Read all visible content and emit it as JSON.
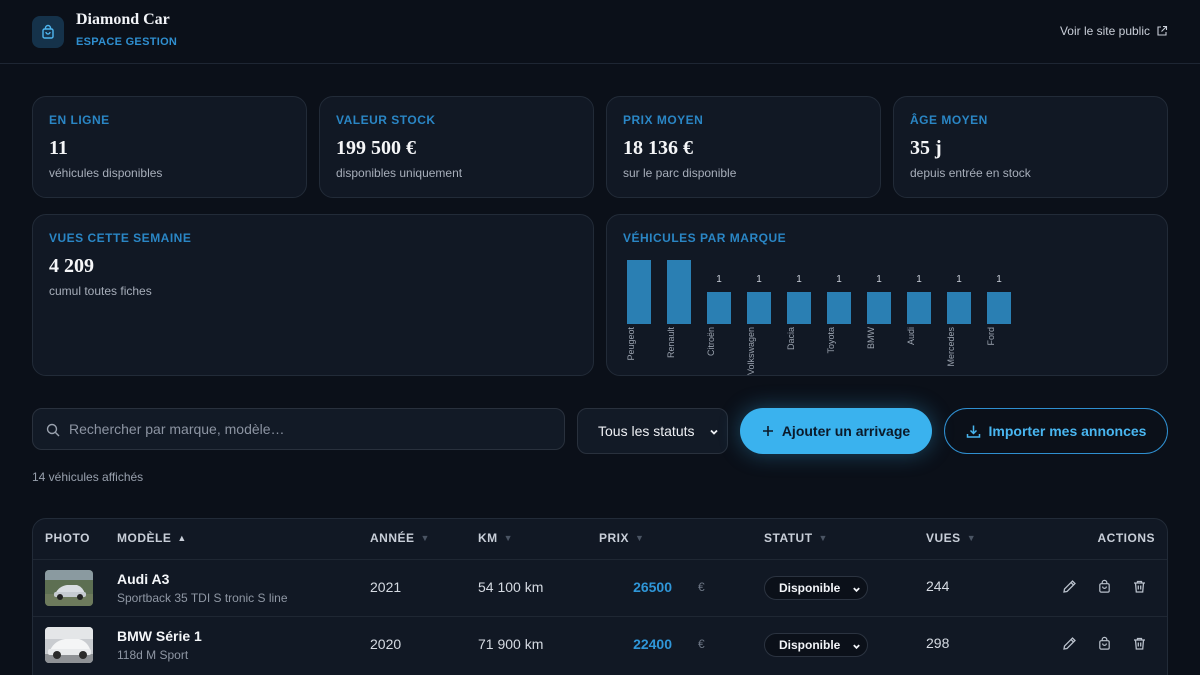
{
  "header": {
    "brand_name": "Diamond Car",
    "brand_sub": "ESPACE GESTION",
    "public_link": "Voir le site public"
  },
  "stats": [
    {
      "label": "EN LIGNE",
      "value": "11",
      "sub": "véhicules disponibles"
    },
    {
      "label": "VALEUR STOCK",
      "value": "199 500 €",
      "sub": "disponibles uniquement"
    },
    {
      "label": "PRIX MOYEN",
      "value": "18 136 €",
      "sub": "sur le parc disponible"
    },
    {
      "label": "ÂGE MOYEN",
      "value": "35 j",
      "sub": "depuis entrée en stock"
    },
    {
      "label": "VUES CETTE SEMAINE",
      "value": "4 209",
      "sub": "cumul toutes fiches"
    }
  ],
  "chart_data": {
    "type": "bar",
    "title": "VÉHICULES PAR MARQUE",
    "categories": [
      "Peugeot",
      "Renault",
      "Citroën",
      "Volkswagen",
      "Dacia",
      "Toyota",
      "BMW",
      "Audi",
      "Mercedes",
      "Ford"
    ],
    "values": [
      2,
      2,
      1,
      1,
      1,
      1,
      1,
      1,
      1,
      1
    ],
    "data_labels": [
      "",
      "",
      "1",
      "1",
      "1",
      "1",
      "1",
      "1",
      "1",
      "1"
    ],
    "ylim": [
      0,
      2
    ],
    "color": "#2a7fb3"
  },
  "toolbar": {
    "search_placeholder": "Rechercher par marque, modèle…",
    "status_filter": "Tous les statuts",
    "add_label": "Ajouter un arrivage",
    "import_label": "Importer mes annonces",
    "count_text": "14 véhicules affichés"
  },
  "table": {
    "headers": {
      "photo": "PHOTO",
      "model": "MODÈLE",
      "year": "ANNÉE",
      "km": "KM",
      "price": "PRIX",
      "status": "STATUT",
      "views": "VUES",
      "actions": "ACTIONS"
    },
    "rows": [
      {
        "model": "Audi A3",
        "trim": "Sportback 35 TDI S tronic S line",
        "year": "2021",
        "km": "54 100 km",
        "price": "26500",
        "currency": "€",
        "status": "Disponible",
        "views": "244"
      },
      {
        "model": "BMW Série 1",
        "trim": "118d M Sport",
        "year": "2020",
        "km": "71 900 km",
        "price": "22400",
        "currency": "€",
        "status": "Disponible",
        "views": "298"
      }
    ]
  },
  "icons": {
    "logo": "bag-icon",
    "external": "external-link-icon",
    "search": "search-icon",
    "add": "plus-icon",
    "import": "download-icon",
    "edit": "pencil-icon",
    "sell": "bag-icon",
    "delete": "trash-icon"
  }
}
